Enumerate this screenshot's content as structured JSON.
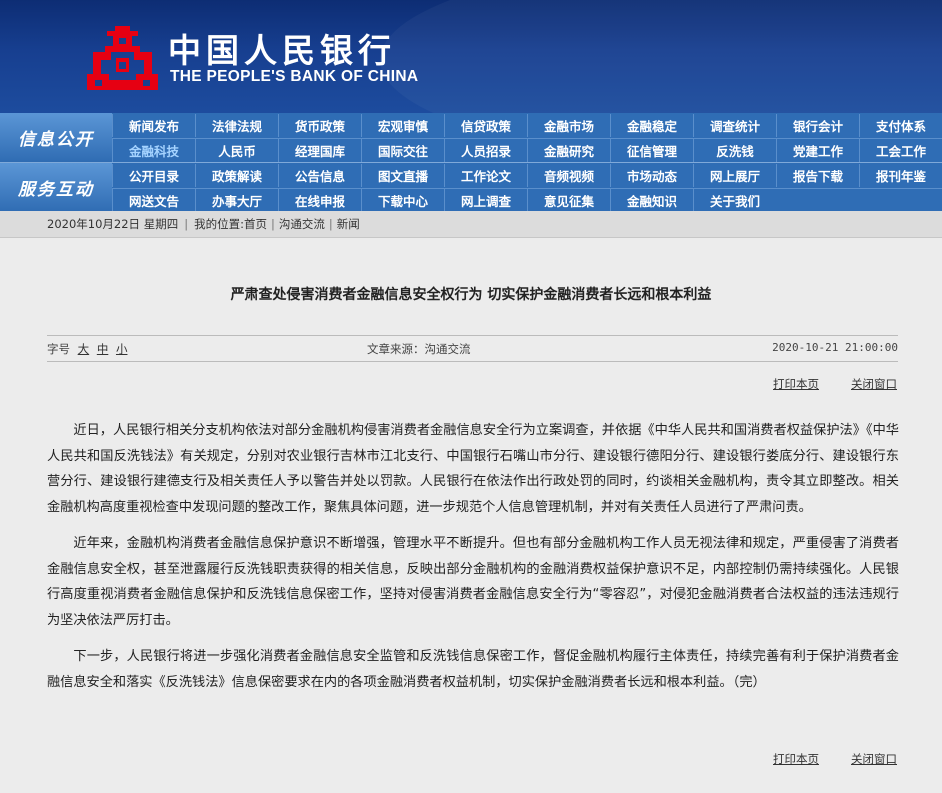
{
  "header": {
    "name_cn": "中国人民银行",
    "name_en": "THE PEOPLE'S BANK OF CHINA",
    "logo_color": "#e60012"
  },
  "nav": {
    "sections": [
      {
        "label": "信息公开",
        "rows": [
          [
            "新闻发布",
            "法律法规",
            "货币政策",
            "宏观审慎",
            "信贷政策",
            "金融市场",
            "金融稳定",
            "调查统计",
            "银行会计",
            "支付体系"
          ],
          [
            "金融科技",
            "人民币",
            "经理国库",
            "国际交往",
            "人员招录",
            "金融研究",
            "征信管理",
            "反洗钱",
            "党建工作",
            "工会工作"
          ]
        ]
      },
      {
        "label": "服务互动",
        "rows": [
          [
            "公开目录",
            "政策解读",
            "公告信息",
            "图文直播",
            "工作论文",
            "音频视频",
            "市场动态",
            "网上展厅",
            "报告下载",
            "报刊年鉴"
          ],
          [
            "网送文告",
            "办事大厅",
            "在线申报",
            "下载中心",
            "网上调查",
            "意见征集",
            "金融知识",
            "关于我们"
          ]
        ]
      }
    ],
    "active_item": "金融科技",
    "bg_color": "#2f6db5"
  },
  "breadcrumb": {
    "date": "2020年10月22日 星期四",
    "location_label": "我的位置:",
    "items": [
      "首页",
      "沟通交流",
      "新闻"
    ]
  },
  "article": {
    "title": "严肃查处侵害消费者金融信息安全权行为  切实保护金融消费者长远和根本利益",
    "font_size_label": "字号",
    "font_sizes": [
      "大",
      "中",
      "小"
    ],
    "source": "文章来源：沟通交流",
    "date": "2020-10-21  21:00:00",
    "print_label": "打印本页",
    "close_label": "关闭窗口",
    "paragraphs": [
      "近日，人民银行相关分支机构依法对部分金融机构侵害消费者金融信息安全行为立案调查，并依据《中华人民共和国消费者权益保护法》《中华人民共和国反洗钱法》有关规定，分别对农业银行吉林市江北支行、中国银行石嘴山市分行、建设银行德阳分行、建设银行娄底分行、建设银行东营分行、建设银行建德支行及相关责任人予以警告并处以罚款。人民银行在依法作出行政处罚的同时，约谈相关金融机构，责令其立即整改。相关金融机构高度重视检查中发现问题的整改工作，聚焦具体问题，进一步规范个人信息管理机制，并对有关责任人员进行了严肃问责。",
      "近年来，金融机构消费者金融信息保护意识不断增强，管理水平不断提升。但也有部分金融机构工作人员无视法律和规定，严重侵害了消费者金融信息安全权，甚至泄露履行反洗钱职责获得的相关信息，反映出部分金融机构的金融消费权益保护意识不足，内部控制仍需持续强化。人民银行高度重视消费者金融信息保护和反洗钱信息保密工作，坚持对侵害消费者金融信息安全行为“零容忍”，对侵犯金融消费者合法权益的违法违规行为坚决依法严厉打击。",
      "下一步，人民银行将进一步强化消费者金融信息安全监管和反洗钱信息保密工作，督促金融机构履行主体责任，持续完善有利于保护消费者金融信息安全和落实《反洗钱法》信息保密要求在内的各项金融消费者权益机制，切实保护金融消费者长远和根本利益。（完）"
    ]
  }
}
